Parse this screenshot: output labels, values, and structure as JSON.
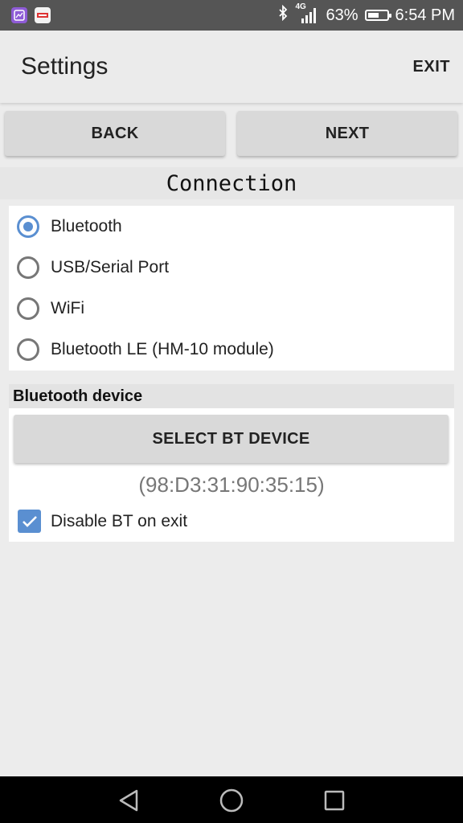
{
  "status_bar": {
    "network": "4G",
    "battery_percent": "63%",
    "battery_level": 0.63,
    "time": "6:54 PM",
    "icons": [
      "gallery-app-icon",
      "app-icon",
      "bluetooth-icon",
      "signal-icon",
      "battery-icon"
    ]
  },
  "header": {
    "title": "Settings",
    "exit_label": "EXIT"
  },
  "nav": {
    "back_label": "BACK",
    "next_label": "NEXT"
  },
  "connection": {
    "title": "Connection",
    "options": [
      {
        "label": "Bluetooth",
        "selected": true
      },
      {
        "label": "USB/Serial Port",
        "selected": false
      },
      {
        "label": "WiFi",
        "selected": false
      },
      {
        "label": "Bluetooth LE (HM-10 module)",
        "selected": false
      }
    ]
  },
  "bluetooth": {
    "title": "Bluetooth device",
    "select_label": "SELECT BT DEVICE",
    "address": "(98:D3:31:90:35:15)",
    "disable_on_exit_label": "Disable BT on exit",
    "disable_on_exit_checked": true
  },
  "colors": {
    "accent": "#5a8fd1",
    "status_bar": "#555555",
    "background": "#ececec"
  },
  "navbar": {
    "icons": [
      "back-triangle-icon",
      "home-circle-icon",
      "recents-square-icon"
    ]
  }
}
